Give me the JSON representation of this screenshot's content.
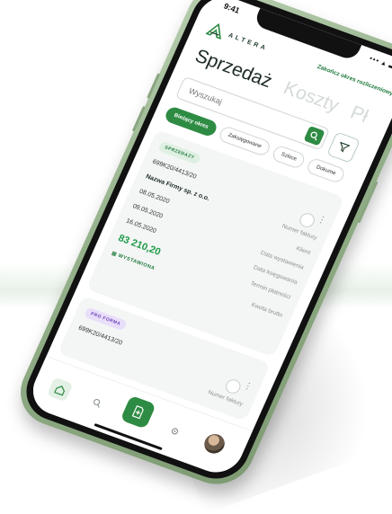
{
  "status_bar": {
    "time": "9:41",
    "icons": "••• ▴ ▬"
  },
  "header": {
    "logo_text": "ALTERA",
    "close_period_label": "Zakończ okres rozliczeniowy"
  },
  "tabs": [
    {
      "label": "Sprzedaż",
      "active": true
    },
    {
      "label": "Koszty",
      "active": false
    },
    {
      "label": "Pł",
      "active": false
    }
  ],
  "search": {
    "placeholder": "Wyszukaj",
    "value": ""
  },
  "chips": [
    {
      "label": "Bieżący okres",
      "active": true
    },
    {
      "label": "Zaksięgowane",
      "active": false
    },
    {
      "label": "Szkice",
      "active": false
    },
    {
      "label": "Dokume",
      "active": false
    }
  ],
  "invoice_card": {
    "badge": "SPRZEDAŻY",
    "number": "699K20/4413/20",
    "number_label": "Numer faktury",
    "client": "Nazwa Firmy sp. z o.o.",
    "client_label": "Klient",
    "issue_date": "08.05.2020",
    "issue_label": "Data wystawienia",
    "posting_date": "09.05.2020",
    "posting_label": "Data księgowania",
    "due_date": "16.05.2020",
    "due_label": "Termin płatności",
    "amount": "83 210,20",
    "amount_label": "Kwota brutto",
    "status": "WYSTAWIONA"
  },
  "proforma_card": {
    "badge": "PRO FORMA",
    "number": "699K20/4413/20",
    "number_label": "Numer faktury"
  },
  "colors": {
    "accent": "#2e8b43",
    "amount": "#1f9a4a",
    "frame": "#96b28c"
  }
}
